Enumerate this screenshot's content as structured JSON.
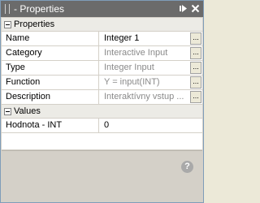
{
  "window": {
    "title": "- Properties",
    "pin_icon": "pin-icon",
    "close_icon": "close-icon"
  },
  "sections": {
    "properties": {
      "label": "Properties",
      "rows": [
        {
          "name": "Name",
          "value": "Integer 1",
          "readonly": false
        },
        {
          "name": "Category",
          "value": "Interactive Input",
          "readonly": true
        },
        {
          "name": "Type",
          "value": "Integer Input",
          "readonly": true
        },
        {
          "name": "Function",
          "value": "Y = input(INT)",
          "readonly": true
        },
        {
          "name": "Description",
          "value": "Interaktívny vstup ...",
          "readonly": true
        }
      ]
    },
    "values": {
      "label": "Values",
      "rows": [
        {
          "name": "Hodnota - INT",
          "value": "0"
        }
      ]
    }
  },
  "ellipsis_label": "...",
  "help_label": "?"
}
